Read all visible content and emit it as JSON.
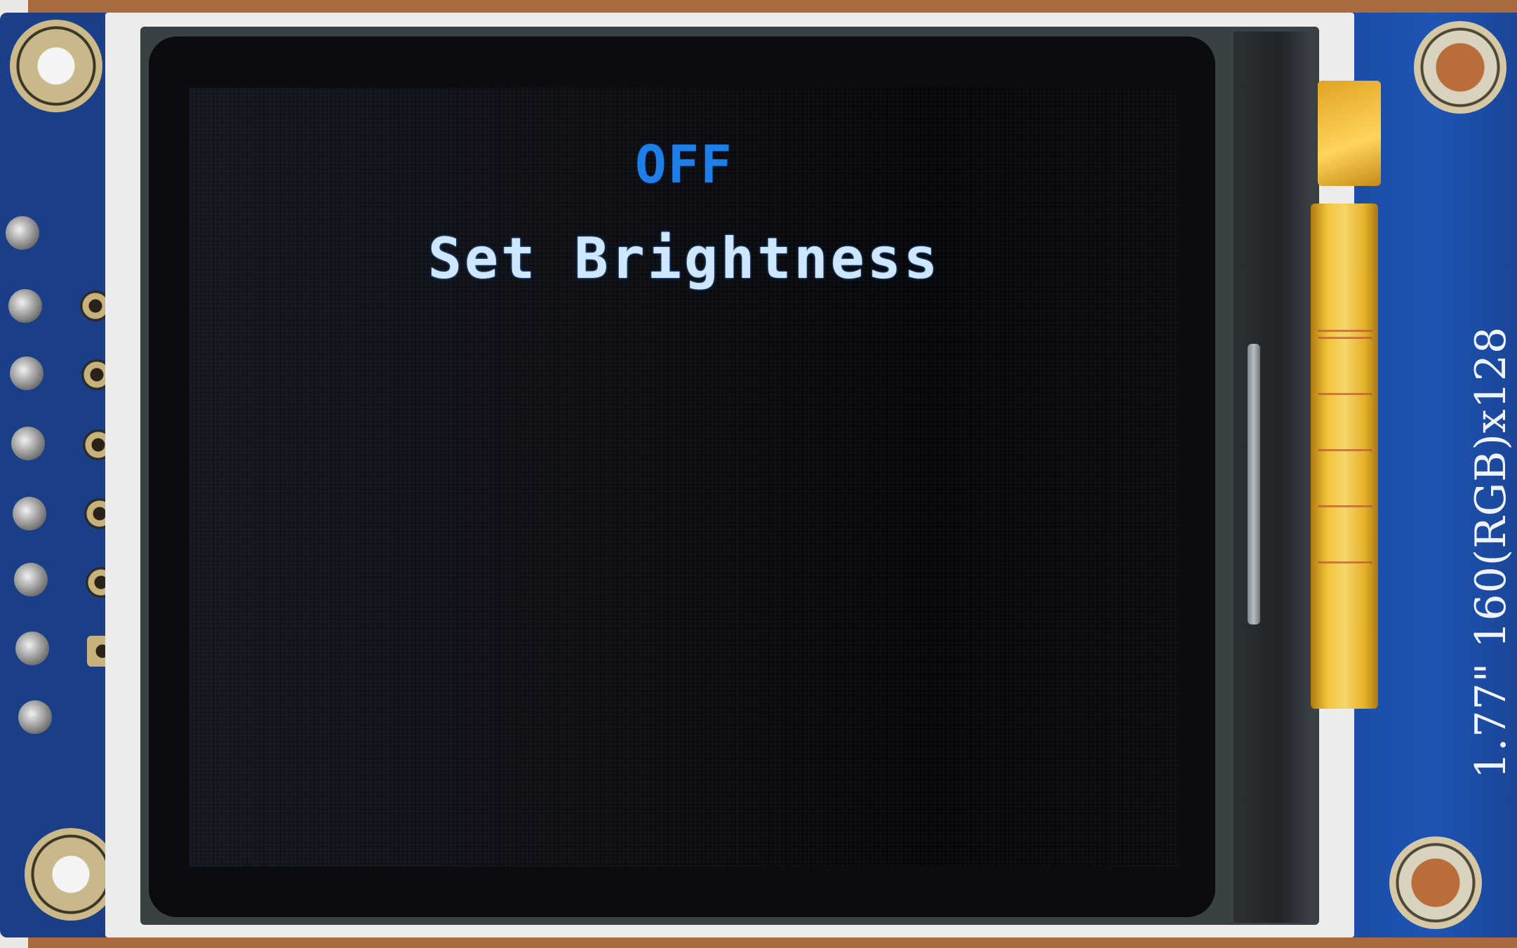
{
  "display": {
    "status_text": "OFF",
    "menu_text": "Set Brightness"
  },
  "board": {
    "label": "1.77\" 160(RGB)x128"
  },
  "colors": {
    "status_text": "#1f7fe8",
    "menu_text": "#cfe6ff",
    "screen_bg": "#0b0d12",
    "pcb": "#1b4aa0"
  }
}
